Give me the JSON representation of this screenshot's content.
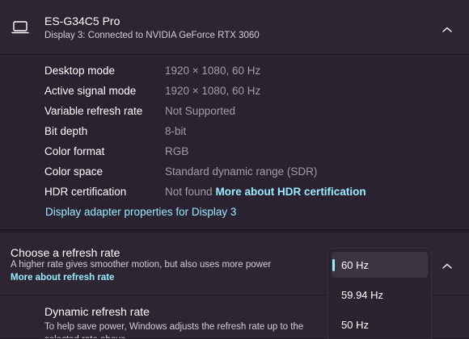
{
  "device": {
    "name": "ES-G34C5 Pro",
    "subtitle": "Display 3: Connected to NVIDIA GeForce RTX 3060",
    "icon": "laptop-icon"
  },
  "display_info": [
    {
      "label": "Desktop mode",
      "value": "1920 × 1080, 60 Hz"
    },
    {
      "label": "Active signal mode",
      "value": "1920 × 1080, 60 Hz"
    },
    {
      "label": "Variable refresh rate",
      "value": "Not Supported"
    },
    {
      "label": "Bit depth",
      "value": "8-bit"
    },
    {
      "label": "Color format",
      "value": "RGB"
    },
    {
      "label": "Color space",
      "value": "Standard dynamic range (SDR)"
    },
    {
      "label": "HDR certification",
      "value": "Not found",
      "link": "More about HDR certification"
    }
  ],
  "adapter_link": "Display adapter properties for Display 3",
  "refresh_rate": {
    "title": "Choose a refresh rate",
    "description": "A higher rate gives smoother motion, but also uses more power",
    "link": "More about refresh rate",
    "options": [
      "60 Hz",
      "59.94 Hz",
      "50 Hz"
    ],
    "selected": "60 Hz"
  },
  "dynamic_refresh": {
    "title": "Dynamic refresh rate",
    "description": "To help save power, Windows adjusts the refresh rate up to the selected rate above"
  },
  "colors": {
    "background": "#241c2a",
    "card": "#2e2533",
    "accent_link": "#99ebff",
    "secondary_text": "#a39ea8"
  }
}
